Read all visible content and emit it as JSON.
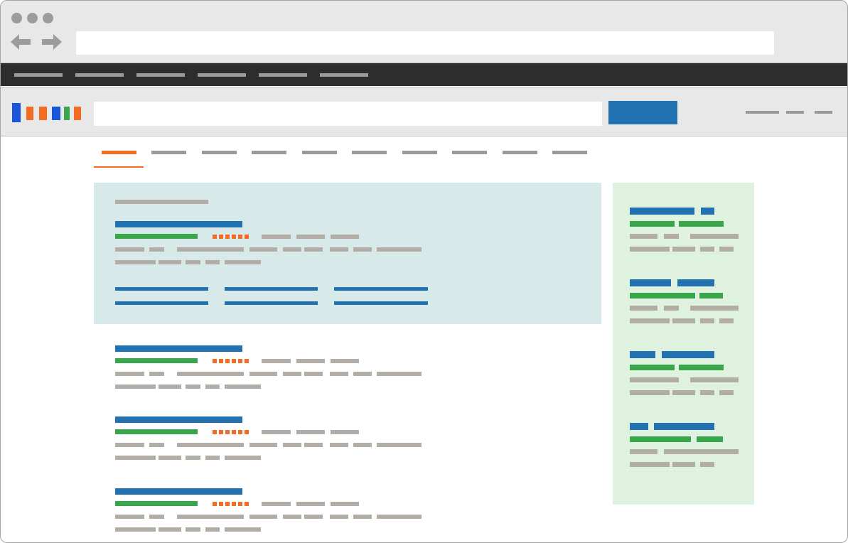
{
  "window": {
    "traffic_lights": [
      "close",
      "minimize",
      "zoom"
    ],
    "nav_icons": [
      "back-arrow-icon",
      "forward-arrow-icon"
    ],
    "address_bar": {
      "value": "",
      "placeholder": ""
    }
  },
  "top_nav": {
    "item_count": 6
  },
  "header": {
    "logo_colors": [
      "#1a56db",
      "#f36c21",
      "#f36c21",
      "#1a56db",
      "#3aa64c",
      "#f36c21"
    ],
    "search": {
      "value": "",
      "placeholder": ""
    },
    "search_button_label": "",
    "header_links": 3
  },
  "tabs": {
    "count": 10,
    "active_index": 0
  },
  "results": {
    "featured": true,
    "count": 4,
    "rating_dots": 6
  },
  "sidebar": {
    "card_count": 4
  },
  "colors": {
    "accent_orange": "#f36c21",
    "link_blue": "#2271b1",
    "url_green": "#3aa64c",
    "text_gray": "#b3ada7",
    "featured_bg": "#d8e9ea",
    "sidebar_bg": "#dff1df",
    "dark_nav": "#2d2d2d"
  }
}
